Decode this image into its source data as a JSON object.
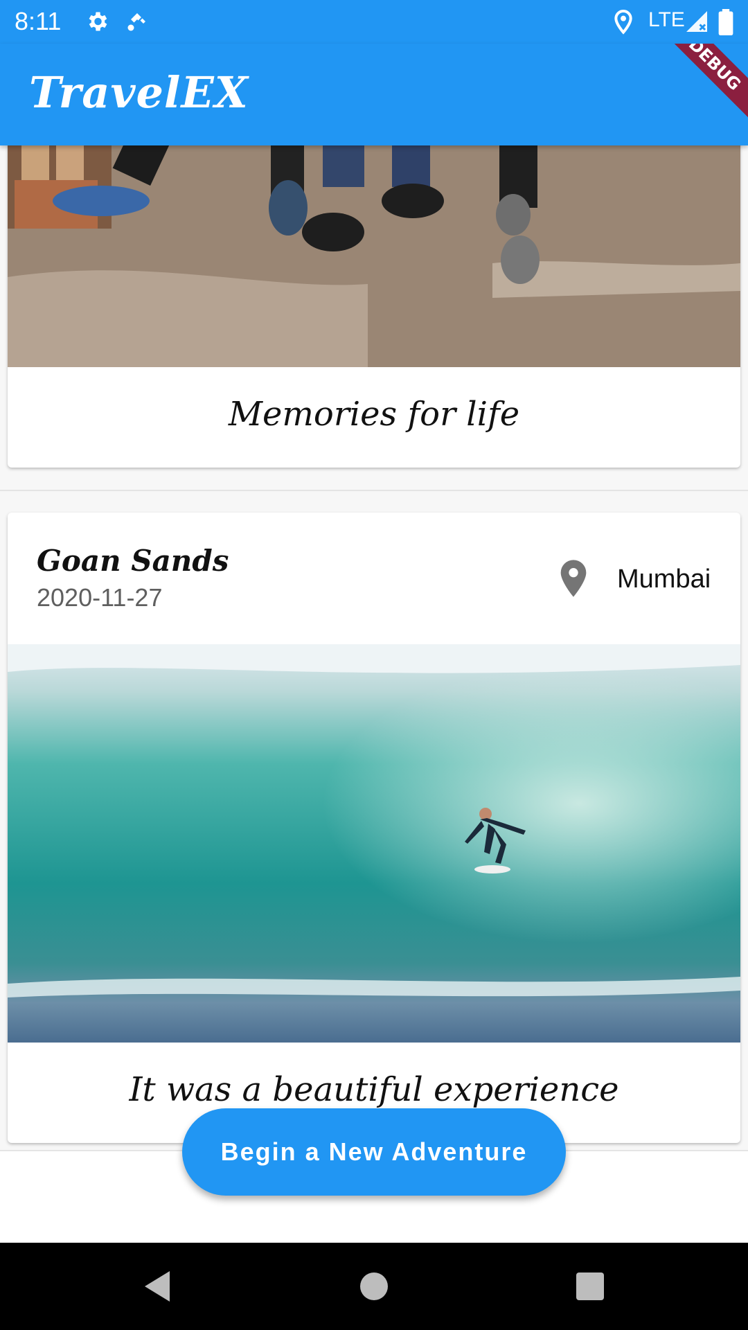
{
  "status_bar": {
    "time": "8:11",
    "network": "LTE",
    "icons": [
      "gear-icon",
      "satellite-icon",
      "location-icon",
      "signal-icon",
      "battery-icon"
    ]
  },
  "app_bar": {
    "title": "TravelEX",
    "debug_banner": "DEBUG",
    "background": "#2196f3"
  },
  "cards": [
    {
      "caption": "Memories for life",
      "image": "photo of people's feet in sneakers standing on sandy ground"
    },
    {
      "title": "Goan Sands",
      "date": "2020-11-27",
      "location": "Mumbai",
      "image": "photo of a surfer riding inside a large turquoise wave",
      "caption": "It was a beautiful experience"
    }
  ],
  "fab": {
    "label": "Begin a New Adventure"
  },
  "nav_bar": {
    "icons": [
      "back-icon",
      "home-icon",
      "recents-icon"
    ]
  }
}
